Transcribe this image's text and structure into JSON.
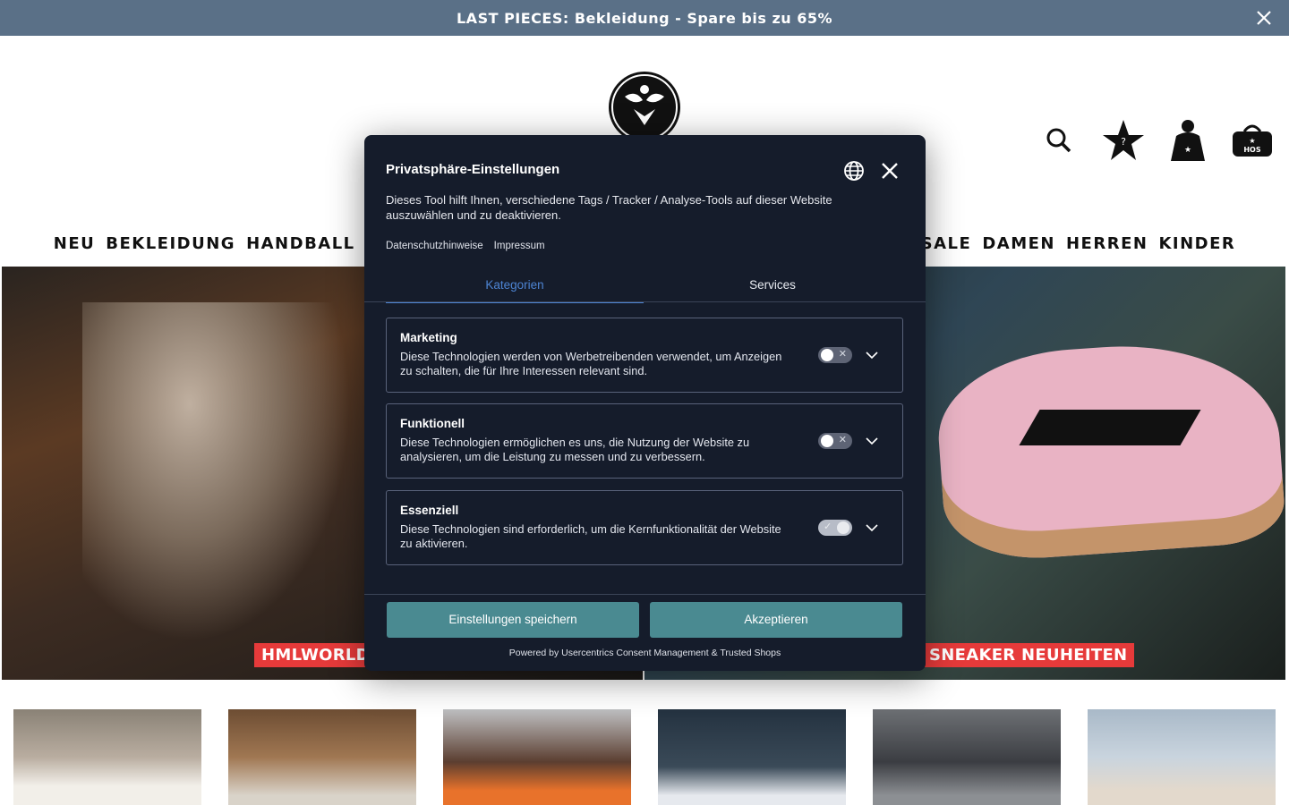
{
  "promo": {
    "text": "LAST PIECES: Bekleidung - Spare bis zu 65%"
  },
  "nav": {
    "left": [
      "NEU",
      "BEKLEIDUNG",
      "HANDBALL"
    ],
    "right": [
      "SALE",
      "DAMEN",
      "HERREN",
      "KINDER"
    ]
  },
  "hero": {
    "left_label": "HMLWORLD",
    "right_label": "SNEAKER NEUHEITEN"
  },
  "consent": {
    "title": "Privatsphäre-Einstellungen",
    "description": "Dieses Tool hilft Ihnen, verschiedene Tags / Tracker / Analyse-Tools auf dieser Website auszuwählen und zu deaktivieren.",
    "links": {
      "privacy": "Datenschutzhinweise",
      "imprint": "Impressum"
    },
    "tabs": {
      "categories": "Kategorien",
      "services": "Services"
    },
    "categories": [
      {
        "title": "Marketing",
        "description": "Diese Technologien werden von Werbetreibenden verwendet, um Anzeigen zu schalten, die für Ihre Interessen relevant sind."
      },
      {
        "title": "Funktionell",
        "description": "Diese Technologien ermöglichen es uns, die Nutzung der Website zu analysieren, um die Leistung zu messen und zu verbessern."
      },
      {
        "title": "Essenziell",
        "description": "Diese Technologien sind erforderlich, um die Kernfunktionalität der Website zu aktivieren."
      }
    ],
    "save_button": "Einstellungen speichern",
    "accept_button": "Akzeptieren",
    "powered_by": "Powered by Usercentrics Consent Management & Trusted Shops"
  },
  "colors": {
    "promo_bg": "#5a7087",
    "modal_bg": "#151c2b",
    "button": "#4a8a91",
    "active_tab": "#4d84d3",
    "hero_label": "#e63a3a"
  }
}
